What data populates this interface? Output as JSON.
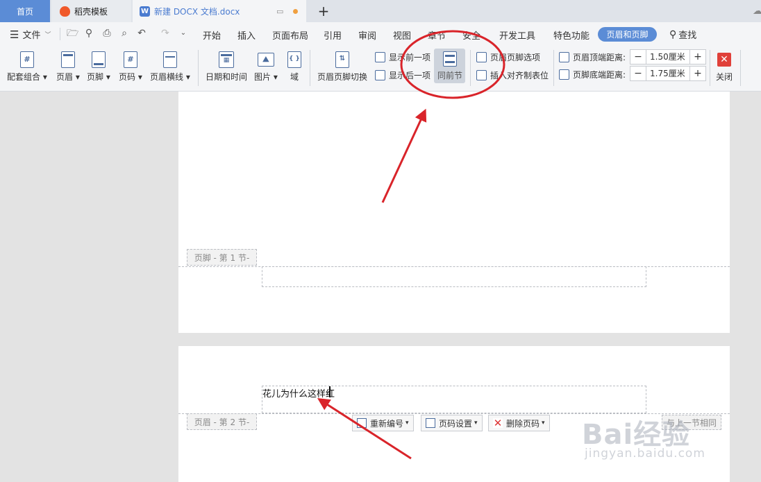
{
  "tabs": {
    "home": "首页",
    "template": "稻壳模板",
    "document": "新建 DOCX 文档.docx",
    "new_tab": "+"
  },
  "menu": {
    "file": "文件",
    "items": [
      "开始",
      "插入",
      "页面布局",
      "引用",
      "审阅",
      "视图",
      "章节",
      "安全",
      "开发工具",
      "特色功能"
    ],
    "active": "页眉和页脚",
    "search": "查找"
  },
  "ribbon": {
    "combo": "配套组合",
    "header": "页眉",
    "footer": "页脚",
    "page_number": "页码",
    "header_line": "页眉横线",
    "datetime": "日期和时间",
    "picture": "图片",
    "field": "域",
    "switch": "页眉页脚切换",
    "show_prev": "显示前一项",
    "show_next": "显示后一项",
    "same_as_prev": "同前节",
    "options": "页眉页脚选项",
    "align_tab": "插入对齐制表位",
    "top_distance_label": "页眉顶端距离:",
    "top_distance_value": "1.50厘米",
    "bottom_distance_label": "页脚底端距离:",
    "bottom_distance_value": "1.75厘米",
    "minus": "−",
    "plus": "+",
    "close": "关闭"
  },
  "document": {
    "footer_tag_1": "页脚 - 第 1 节-",
    "header_tag_2": "页眉 - 第 2 节-",
    "header_text": "花儿为什么这样红",
    "renumber": "重新编号",
    "page_setup": "页码设置",
    "delete_page_number": "删除页码",
    "same_as_previous_tag": "与上一节相同"
  },
  "watermark": {
    "main": "Bai经验",
    "sub": "jingyan.baidu.com"
  },
  "colors": {
    "accent": "#5b8cd6",
    "annotation": "#d9242a",
    "close": "#e0403a"
  }
}
